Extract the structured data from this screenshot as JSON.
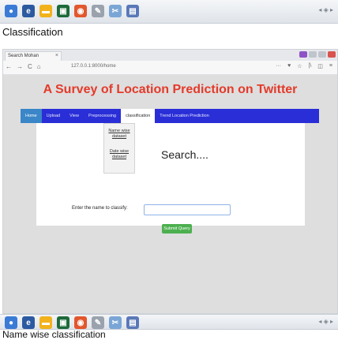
{
  "captions": {
    "top": "Classification",
    "bottom": "Name wise classification"
  },
  "browser": {
    "tab_title": "Search Mohan",
    "tab_close": "×",
    "url": "127.0.0.1:8000/home",
    "nav": {
      "back": "←",
      "forward": "→",
      "reload": "C",
      "home": "⌂"
    },
    "nav_right": {
      "menu": "···",
      "shield": "♥",
      "star": "☆",
      "library": "|\\",
      "sidebar": "◫",
      "more": "≡"
    }
  },
  "site": {
    "title": "A Survey of Location Prediction on Twitter",
    "menu": [
      {
        "label": "Home"
      },
      {
        "label": "Upload"
      },
      {
        "label": "View"
      },
      {
        "label": "Preprocessing"
      },
      {
        "label": "classification"
      },
      {
        "label": "Trend Location Prediction"
      }
    ],
    "dropdown": [
      {
        "label": "Name wise dataset"
      },
      {
        "label": "Date wise dataset"
      }
    ],
    "heading": "Search....",
    "form": {
      "label": "Enter the name to classify:",
      "input_value": "",
      "submit": "Submit Query"
    }
  },
  "colors": {
    "title": "#e43a2a",
    "menubar": "#2a2ed6",
    "submit": "#4cb04f"
  }
}
